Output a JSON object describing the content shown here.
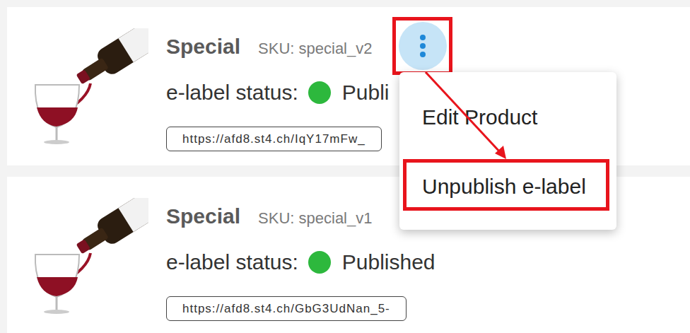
{
  "products": [
    {
      "name": "Special",
      "sku": "SKU: special_v2",
      "status_label": "e-label status:",
      "status": "Publi",
      "published": true,
      "url": "https://afd8.st4.ch/IqY17mFw_",
      "menu_open": true
    },
    {
      "name": "Special",
      "sku": "SKU: special_v1",
      "status_label": "e-label status:",
      "status": "Published",
      "published": true,
      "url": "https://afd8.st4.ch/GbG3UdNan_5-",
      "menu_open": false
    }
  ],
  "menu_button": {
    "annotated": true
  },
  "menu": {
    "items": [
      {
        "label": "Edit Product",
        "annotated": false
      },
      {
        "label": "Unpublish e-label",
        "annotated": true
      }
    ]
  }
}
